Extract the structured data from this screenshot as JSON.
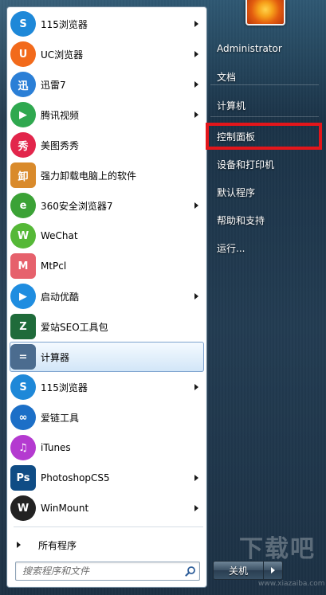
{
  "programs": [
    {
      "label": "115浏览器",
      "icon": "115-browser-icon",
      "glyph": "S",
      "color": "#1e88d8",
      "arrow": true
    },
    {
      "label": "UC浏览器",
      "icon": "uc-browser-icon",
      "glyph": "U",
      "color": "#f26a1b",
      "arrow": true
    },
    {
      "label": "迅雷7",
      "icon": "xunlei-icon",
      "glyph": "迅",
      "color": "#2b7fd6",
      "arrow": true
    },
    {
      "label": "腾讯视频",
      "icon": "tencent-video-icon",
      "glyph": "▶",
      "color": "#2fa84f",
      "arrow": true
    },
    {
      "label": "美图秀秀",
      "icon": "meitu-icon",
      "glyph": "秀",
      "color": "#e2254b",
      "arrow": false
    },
    {
      "label": "强力卸载电脑上的软件",
      "icon": "uninstall-icon",
      "glyph": "卸",
      "color": "#d98a2b",
      "arrow": false
    },
    {
      "label": "360安全浏览器7",
      "icon": "360-browser-icon",
      "glyph": "e",
      "color": "#3ba236",
      "arrow": true
    },
    {
      "label": "WeChat",
      "icon": "wechat-icon",
      "glyph": "W",
      "color": "#55b837",
      "arrow": false
    },
    {
      "label": "MtPcl",
      "icon": "mtpcl-icon",
      "glyph": "M",
      "color": "#e6616c",
      "arrow": false
    },
    {
      "label": "启动优酷",
      "icon": "youku-icon",
      "glyph": "▶",
      "color": "#1f8de0",
      "arrow": true
    },
    {
      "label": "爱站SEO工具包",
      "icon": "aizhan-seo-icon",
      "glyph": "Z",
      "color": "#1f6b3a",
      "arrow": false
    },
    {
      "label": "计算器",
      "icon": "calculator-icon",
      "glyph": "=",
      "color": "#4b6c8f",
      "arrow": false
    },
    {
      "label": "115浏览器",
      "icon": "115-browser-icon",
      "glyph": "S",
      "color": "#1e88d8",
      "arrow": true
    },
    {
      "label": "爱链工具",
      "icon": "ailian-icon",
      "glyph": "∞",
      "color": "#1c6fc7",
      "arrow": false
    },
    {
      "label": "iTunes",
      "icon": "itunes-icon",
      "glyph": "♫",
      "color": "#b43ad0",
      "arrow": false
    },
    {
      "label": "PhotoshopCS5",
      "icon": "photoshop-icon",
      "glyph": "Ps",
      "color": "#0f4c85",
      "arrow": true
    },
    {
      "label": "WinMount",
      "icon": "winmount-icon",
      "glyph": "W",
      "color": "#222222",
      "arrow": true
    }
  ],
  "highlighted_index": 11,
  "all_programs_label": "所有程序",
  "search": {
    "placeholder": "搜索程序和文件"
  },
  "right_items": [
    {
      "label": "Administrator",
      "name": "user-name-link"
    },
    {
      "label": "文档",
      "name": "documents-link"
    },
    {
      "label": "计算机",
      "name": "computer-link"
    },
    {
      "label": "控制面板",
      "name": "control-panel-link",
      "boxed": true
    },
    {
      "label": "设备和打印机",
      "name": "devices-printers-link"
    },
    {
      "label": "默认程序",
      "name": "default-programs-link"
    },
    {
      "label": "帮助和支持",
      "name": "help-support-link"
    },
    {
      "label": "运行...",
      "name": "run-link"
    }
  ],
  "shutdown": {
    "label": "关机"
  },
  "watermark": {
    "title": "下载吧",
    "url": "www.xiazaiba.com"
  },
  "colors": {
    "highlight_box": "#e3161b",
    "accent": "#7da2ce"
  }
}
